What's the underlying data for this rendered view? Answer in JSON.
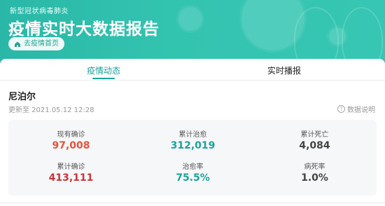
{
  "banner": {
    "subtitle": "新型冠状病毒肺炎",
    "title": "疫情实时大数据报告",
    "home_button": "去疫情首页"
  },
  "tabs": [
    {
      "label": "疫情动态",
      "active": true
    },
    {
      "label": "实时播报",
      "active": false
    }
  ],
  "region": {
    "name": "尼泊尔",
    "updated": "更新至 2021.05.12 12:28",
    "help": "数据说明"
  },
  "stats": [
    {
      "label": "现有确诊",
      "value": "97,008",
      "color": "#e5523b"
    },
    {
      "label": "累计治愈",
      "value": "312,019",
      "color": "#1aa39b"
    },
    {
      "label": "累计死亡",
      "value": "4,084",
      "color": "#444444"
    },
    {
      "label": "累计确诊",
      "value": "413,111",
      "color": "#c8343a"
    },
    {
      "label": "治愈率",
      "value": "75.5%",
      "color": "#1aa39b"
    },
    {
      "label": "病死率",
      "value": "1.0%",
      "color": "#444444"
    }
  ],
  "colors": {
    "accent": "#1aa39b",
    "banner": "#33c4b0"
  }
}
